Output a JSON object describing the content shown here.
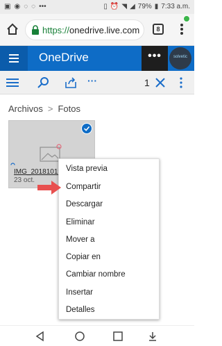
{
  "status_bar": {
    "battery": "79%",
    "time": "7:33 a.m."
  },
  "browser": {
    "url_scheme": "https://",
    "url_host": "onedrive.live.com",
    "tab_count": "8"
  },
  "header": {
    "app_title": "OneDrive",
    "more_label": "•••",
    "avatar_text": "solvetic"
  },
  "command_bar": {
    "selection_count": "1",
    "more_label": "···"
  },
  "breadcrumb": {
    "items": [
      "Archivos",
      "Fotos"
    ],
    "separator": ">"
  },
  "tile": {
    "file_name": "IMG_20181019_",
    "date": "23 oct."
  },
  "context_menu": {
    "items": [
      "Vista previa",
      "Compartir",
      "Descargar",
      "Eliminar",
      "Mover a",
      "Copiar en",
      "Cambiar nombre",
      "Insertar",
      "Detalles"
    ]
  },
  "colors": {
    "accent": "#0e6cc6",
    "arrow": "#e8504f",
    "url_green": "#188038"
  }
}
